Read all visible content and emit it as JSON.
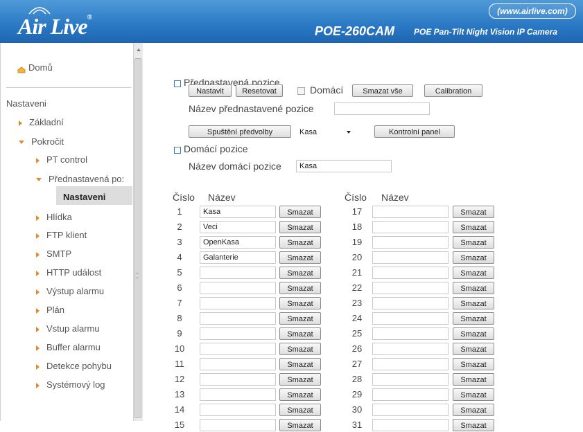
{
  "header": {
    "logo": "Air Live",
    "model": "POE-260CAM",
    "tagline": "POE Pan-Tilt Night Vision IP Camera",
    "url": "(www.airlive.com)"
  },
  "sidebar": {
    "home": "Domů",
    "section": "Nastaveni",
    "basic": "Základní",
    "advanced": "Pokročit",
    "items": {
      "pt_control": "PT control",
      "preset": "Přednastavená po:",
      "preset_sub": "Nastaveni",
      "patrol": "Hlídka",
      "ftp": "FTP klient",
      "smtp": "SMTP",
      "http_event": "HTTP událost",
      "alarm_out": "Výstup alarmu",
      "schedule": "Plán",
      "alarm_in": "Vstup alarmu",
      "alarm_buffer": "Buffer alarmu",
      "motion": "Detekce pohybu",
      "syslog": "Systémový log"
    }
  },
  "preset": {
    "title": "Přednastavená pozice",
    "set_button": "Nastavit",
    "reset_button": "Resetovat",
    "home_label": "Domácí",
    "home_checked": false,
    "delete_all_button": "Smazat vše",
    "calibration_button": "Calibration",
    "name_label": "Název přednastavené pozice",
    "name_value": "",
    "run_button": "Spuštění předvolby",
    "run_select_value": "Kasa",
    "control_panel_button": "Kontrolní panel"
  },
  "home": {
    "title": "Domácí pozice",
    "name_label": "Název domácí pozice",
    "name_value": "Kasa"
  },
  "table": {
    "col_number": "Číslo",
    "col_name": "Název",
    "delete_label": "Smazat",
    "left": [
      {
        "n": "1",
        "name": "Kasa"
      },
      {
        "n": "2",
        "name": "Veci"
      },
      {
        "n": "3",
        "name": "OpenKasa"
      },
      {
        "n": "4",
        "name": "Galanterie"
      },
      {
        "n": "5",
        "name": ""
      },
      {
        "n": "6",
        "name": ""
      },
      {
        "n": "7",
        "name": ""
      },
      {
        "n": "8",
        "name": ""
      },
      {
        "n": "9",
        "name": ""
      },
      {
        "n": "10",
        "name": ""
      },
      {
        "n": "11",
        "name": ""
      },
      {
        "n": "12",
        "name": ""
      },
      {
        "n": "13",
        "name": ""
      },
      {
        "n": "14",
        "name": ""
      },
      {
        "n": "15",
        "name": ""
      }
    ],
    "right": [
      {
        "n": "17",
        "name": ""
      },
      {
        "n": "18",
        "name": ""
      },
      {
        "n": "19",
        "name": ""
      },
      {
        "n": "20",
        "name": ""
      },
      {
        "n": "21",
        "name": ""
      },
      {
        "n": "22",
        "name": ""
      },
      {
        "n": "23",
        "name": ""
      },
      {
        "n": "24",
        "name": ""
      },
      {
        "n": "25",
        "name": ""
      },
      {
        "n": "26",
        "name": ""
      },
      {
        "n": "27",
        "name": ""
      },
      {
        "n": "28",
        "name": ""
      },
      {
        "n": "29",
        "name": ""
      },
      {
        "n": "30",
        "name": ""
      },
      {
        "n": "31",
        "name": ""
      }
    ]
  },
  "colors": {
    "header": "#2a78c4",
    "arrow": "#e3882d",
    "section_marker": "#3a7bc8"
  }
}
